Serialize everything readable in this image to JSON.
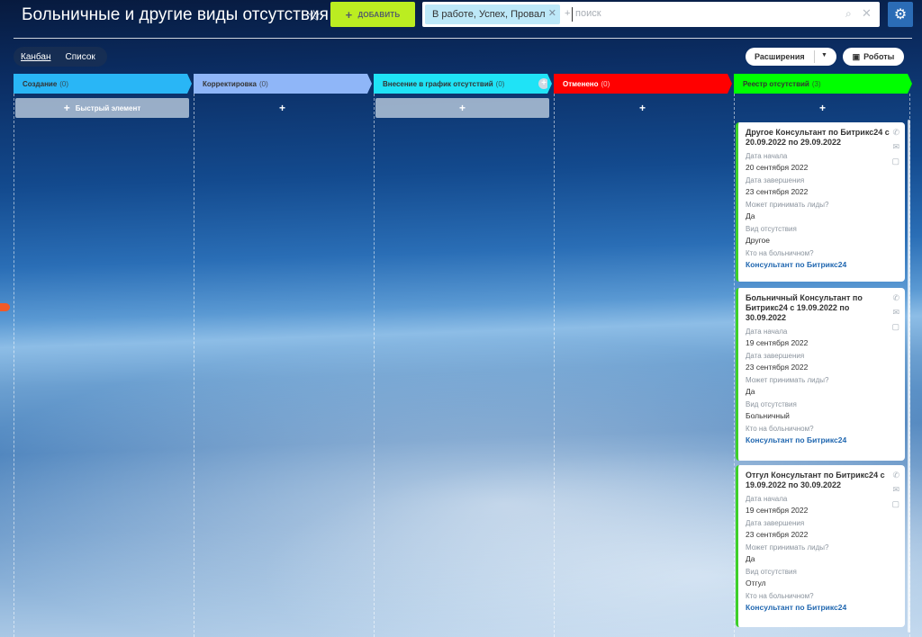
{
  "header": {
    "title": "Больничные и другие виды отсутствия",
    "add_label": "ДОБАВИТЬ",
    "filter_chip": "В работе, Успех, Провал",
    "add_field": "+",
    "search_placeholder": "поиск"
  },
  "toolbar": {
    "view_kanban": "Канбан",
    "view_list": "Список",
    "extensions": "Расширения",
    "robots": "Роботы"
  },
  "columns": [
    {
      "title": "Создание",
      "count": "(0)",
      "color": "#29b6f6",
      "quick": "Быстрый элемент"
    },
    {
      "title": "Корректировка",
      "count": "(0)",
      "color": "#8fb6f8"
    },
    {
      "title": "Внесение в график отсутствий",
      "count": "(0)",
      "color": "#1fe3f6"
    },
    {
      "title": "Отменено",
      "count": "(0)",
      "color": "#ff0000"
    },
    {
      "title": "Реестр отсутствий",
      "count": "(3)",
      "color": "#00ff00"
    }
  ],
  "cards": [
    {
      "title": "Другое Консультант по Битрикс24 с 20.09.2022 по 29.09.2022",
      "start_label": "Дата начала",
      "start": "20 сентября 2022",
      "end_label": "Дата завершения",
      "end": "23 сентября 2022",
      "leads_label": "Может принимать лиды?",
      "leads": "Да",
      "type_label": "Вид отсутствия",
      "type": "Другое",
      "who_label": "Кто на больничном?",
      "who": "Консультант по Битрикс24"
    },
    {
      "title": "Больничный Консультант по Битрикс24 с 19.09.2022 по 30.09.2022",
      "start_label": "Дата начала",
      "start": "19 сентября 2022",
      "end_label": "Дата завершения",
      "end": "23 сентября 2022",
      "leads_label": "Может принимать лиды?",
      "leads": "Да",
      "type_label": "Вид отсутствия",
      "type": "Больничный",
      "who_label": "Кто на больничном?",
      "who": "Консультант по Битрикс24"
    },
    {
      "title": "Отгул Консультант по Битрикс24 с 19.09.2022 по 30.09.2022",
      "start_label": "Дата начала",
      "start": "19 сентября 2022",
      "end_label": "Дата завершения",
      "end": "23 сентября 2022",
      "leads_label": "Может принимать лиды?",
      "leads": "Да",
      "type_label": "Вид отсутствия",
      "type": "Отгул",
      "who_label": "Кто на больничном?",
      "who": "Консультант по Битрикс24"
    }
  ]
}
